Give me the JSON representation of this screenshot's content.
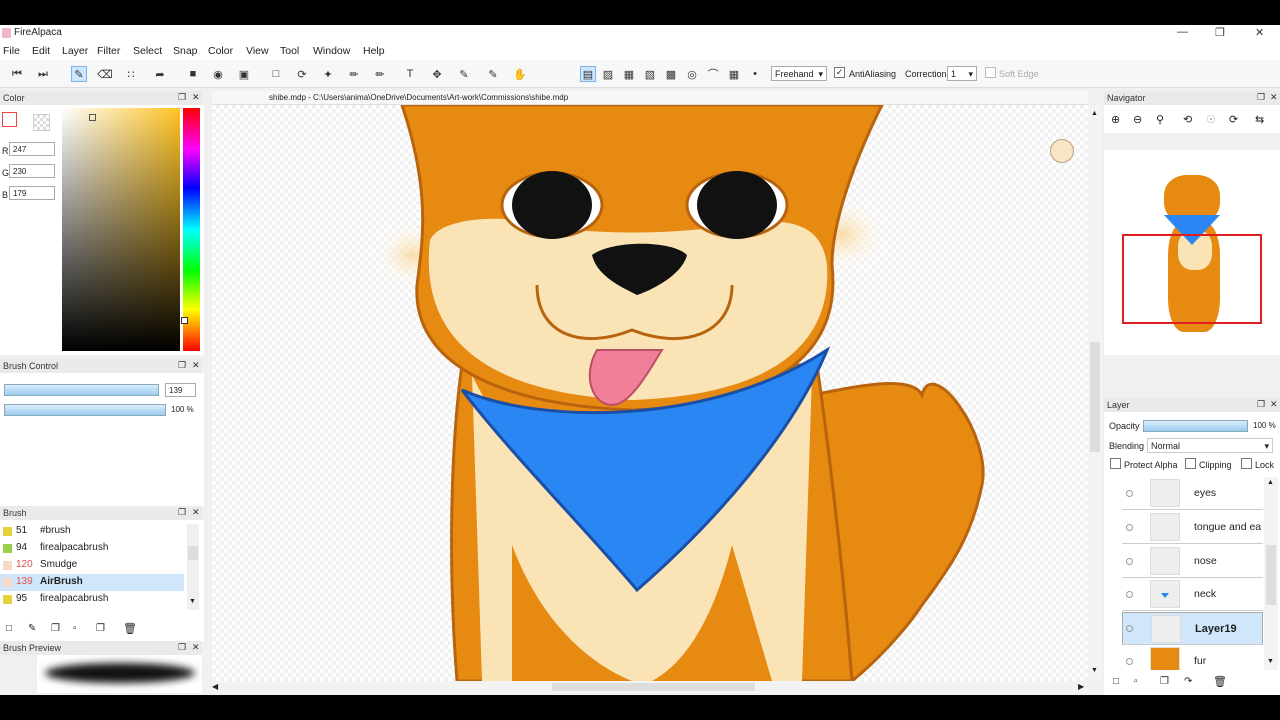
{
  "app": {
    "title": "FireAlpaca"
  },
  "menu": [
    "File",
    "Edit",
    "Layer",
    "Filter",
    "Select",
    "Snap",
    "Color",
    "View",
    "Tool",
    "Window",
    "Help"
  ],
  "toolbar": {
    "mode": "Freehand",
    "antialias_label": "AntiAliasing",
    "correction_label": "Correction",
    "correction_value": "1",
    "soft_edge_label": "Soft Edge"
  },
  "document": {
    "path": "shibe.mdp - C:\\Users\\anima\\OneDrive\\Documents\\Art-work\\Commissions\\shibe.mdp"
  },
  "color_panel": {
    "title": "Color",
    "r_label": "R",
    "r": "247",
    "g_label": "G",
    "g": "230",
    "b_label": "B",
    "b": "179",
    "current_color": "#f7e6b3"
  },
  "brush_control": {
    "title": "Brush Control",
    "size": "139",
    "opacity": "100 %",
    "size_fraction": 0.95,
    "opacity_fraction": 1.0
  },
  "brush_panel": {
    "title": "Brush",
    "items": [
      {
        "size": "51",
        "name": "#brush",
        "color": "#e8d23a"
      },
      {
        "size": "94",
        "name": "firealpacabrush",
        "color": "#9bd14a"
      },
      {
        "size": "120",
        "name": "Smudge",
        "color": "#f6d9c7"
      },
      {
        "size": "139",
        "name": "AirBrush",
        "color": "#f6d9c7"
      },
      {
        "size": "95",
        "name": "firealpacabrush",
        "color": "#e8d23a"
      }
    ]
  },
  "brush_preview": {
    "title": "Brush Preview"
  },
  "navigator": {
    "title": "Navigator"
  },
  "layer_panel": {
    "title": "Layer",
    "opacity_label": "Opacity",
    "opacity_value": "100 %",
    "blending_label": "Blending",
    "blending_value": "Normal",
    "protect_alpha": "Protect Alpha",
    "clipping": "Clipping",
    "lock": "Lock",
    "layers": [
      "eyes",
      "tongue and ea",
      "nose",
      "neck",
      "Layer19",
      "fur"
    ]
  }
}
